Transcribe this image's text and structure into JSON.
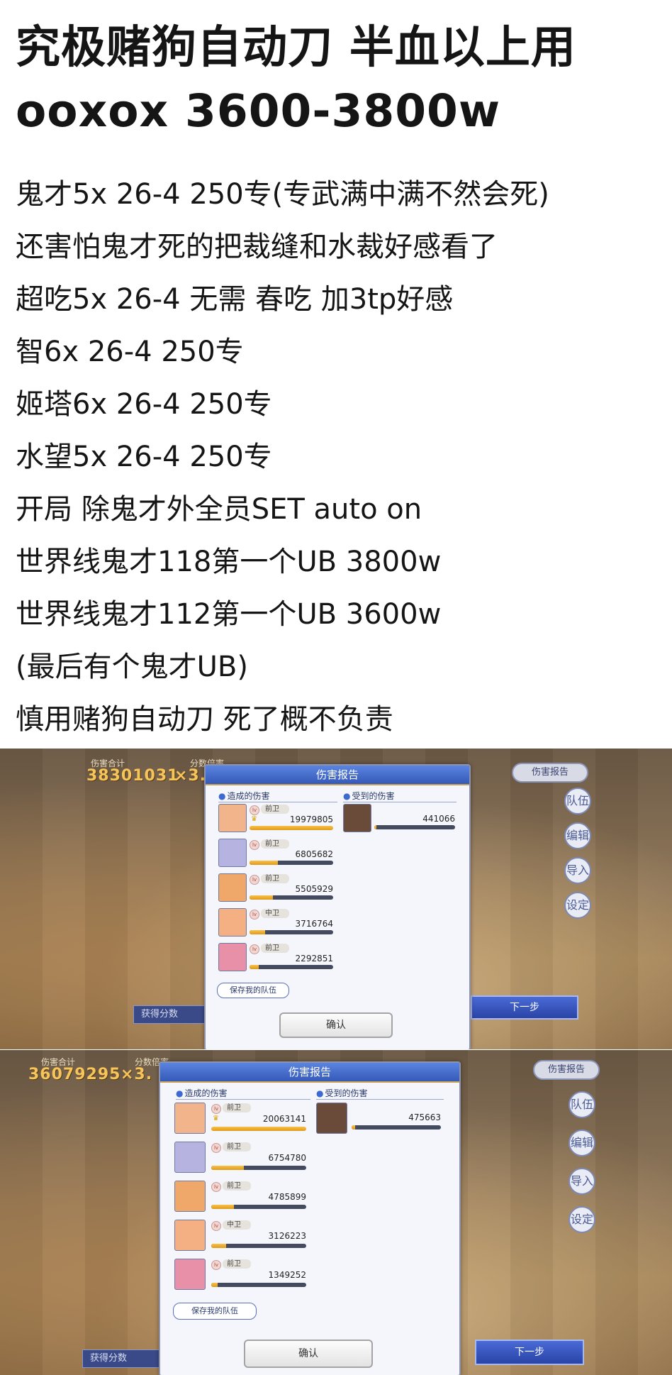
{
  "post": {
    "title": "究极赌狗自动刀 半血以上用 ooxox 3600-3800w",
    "lines": [
      "鬼才5x 26-4 250专(专武满中满不然会死)",
      "还害怕鬼才死的把裁缝和水裁好感看了",
      "超吃5x 26-4 无需 春吃 加3tp好感",
      "智6x 26-4 250专",
      "姬塔6x 26-4  250专",
      "水望5x 26-4 250专",
      "开局 除鬼才外全员SET auto on",
      "世界线鬼才118第一个UB 3800w",
      "世界线鬼才112第一个UB 3600w",
      "(最后有个鬼才UB)",
      "慎用赌狗自动刀 死了概不负责"
    ]
  },
  "screenshots": [
    {
      "total_label": "伤害合计",
      "multiplier_label": "分数倍率",
      "total_value": "38301031",
      "total_suffix": "×3.",
      "top_button": "伤害报告",
      "panel_title": "伤害报告",
      "dealt_header": "造成的伤害",
      "received_header": "受到的伤害",
      "dealt": [
        {
          "role": "前卫",
          "value": "19979805",
          "fill": 1.0,
          "crown": true,
          "portrait_color": "#f2b48a"
        },
        {
          "role": "前卫",
          "value": "6805682",
          "fill": 0.34,
          "crown": false,
          "portrait_color": "#b6b3e0"
        },
        {
          "role": "前卫",
          "value": "5505929",
          "fill": 0.28,
          "crown": false,
          "portrait_color": "#f0a86a"
        },
        {
          "role": "中卫",
          "value": "3716764",
          "fill": 0.19,
          "crown": false,
          "portrait_color": "#f4b082"
        },
        {
          "role": "前卫",
          "value": "2292851",
          "fill": 0.11,
          "crown": false,
          "portrait_color": "#e890a8"
        }
      ],
      "received": [
        {
          "value": "441066",
          "fill": 0.03,
          "portrait_color": "#6a4a38"
        }
      ],
      "save_button": "保存我的队伍",
      "ok_button": "确认",
      "score_label": "获得分数",
      "next_button": "下一步",
      "side_labels": [
        "队伍",
        "编辑",
        "导入",
        "设定"
      ]
    },
    {
      "total_label": "伤害合计",
      "multiplier_label": "分数倍率",
      "total_value": "36079295",
      "total_suffix": "×3.",
      "top_button": "伤害报告",
      "panel_title": "伤害报告",
      "dealt_header": "造成的伤害",
      "received_header": "受到的伤害",
      "dealt": [
        {
          "role": "前卫",
          "value": "20063141",
          "fill": 1.0,
          "crown": true,
          "portrait_color": "#f2b48a"
        },
        {
          "role": "前卫",
          "value": "6754780",
          "fill": 0.34,
          "crown": false,
          "portrait_color": "#b6b3e0"
        },
        {
          "role": "前卫",
          "value": "4785899",
          "fill": 0.24,
          "crown": false,
          "portrait_color": "#f0a86a"
        },
        {
          "role": "中卫",
          "value": "3126223",
          "fill": 0.16,
          "crown": false,
          "portrait_color": "#f4b082"
        },
        {
          "role": "前卫",
          "value": "1349252",
          "fill": 0.07,
          "crown": false,
          "portrait_color": "#e890a8"
        }
      ],
      "received": [
        {
          "value": "475663",
          "fill": 0.04,
          "portrait_color": "#6a4a38"
        }
      ],
      "save_button": "保存我的队伍",
      "ok_button": "确认",
      "score_label": "获得分数",
      "next_button": "下一步",
      "side_labels": [
        "队伍",
        "编辑",
        "导入",
        "设定"
      ]
    }
  ]
}
